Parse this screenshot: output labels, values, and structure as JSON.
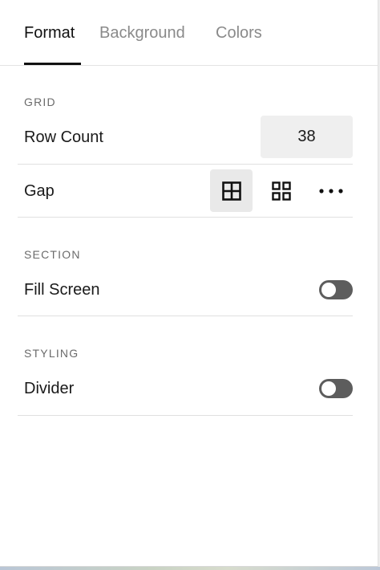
{
  "tabs": [
    {
      "label": "Format",
      "active": true
    },
    {
      "label": "Background",
      "active": false
    },
    {
      "label": "Colors",
      "active": false
    }
  ],
  "grid": {
    "section_label": "GRID",
    "row_count_label": "Row Count",
    "row_count_value": "38",
    "gap_label": "Gap",
    "gap_options": [
      {
        "icon": "grid-no-gap-icon",
        "selected": true
      },
      {
        "icon": "grid-gap-icon",
        "selected": false
      },
      {
        "icon": "more-options-icon",
        "selected": false
      }
    ]
  },
  "section": {
    "section_label": "SECTION",
    "fill_screen_label": "Fill Screen",
    "fill_screen_on": false
  },
  "styling": {
    "section_label": "STYLING",
    "divider_label": "Divider",
    "divider_on": false
  },
  "colors": {
    "text_primary": "#1a1a1a",
    "text_muted": "#8a8a8a",
    "toggle_off": "#5d5d5d",
    "field_bg": "#efefef"
  }
}
